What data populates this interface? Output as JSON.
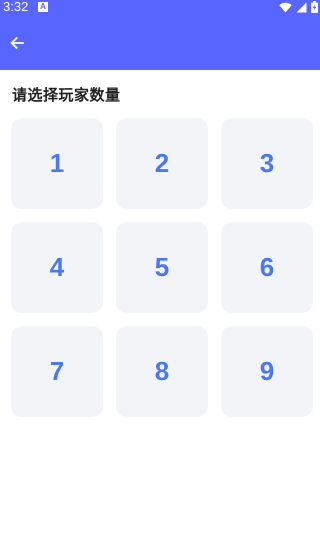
{
  "status_bar": {
    "time": "3:32",
    "notification_badge": "A",
    "icons": [
      "wifi-icon",
      "signal-icon",
      "battery-charging-icon"
    ]
  },
  "app_bar": {
    "back_icon": "arrow-left-icon"
  },
  "prompt": "请选择玩家数量",
  "options": [
    "1",
    "2",
    "3",
    "4",
    "5",
    "6",
    "7",
    "8",
    "9"
  ],
  "colors": {
    "primary": "#5965ff",
    "tile_bg": "#f3f4f8",
    "tile_text": "#4b78f0",
    "prompt_text": "#222222"
  }
}
